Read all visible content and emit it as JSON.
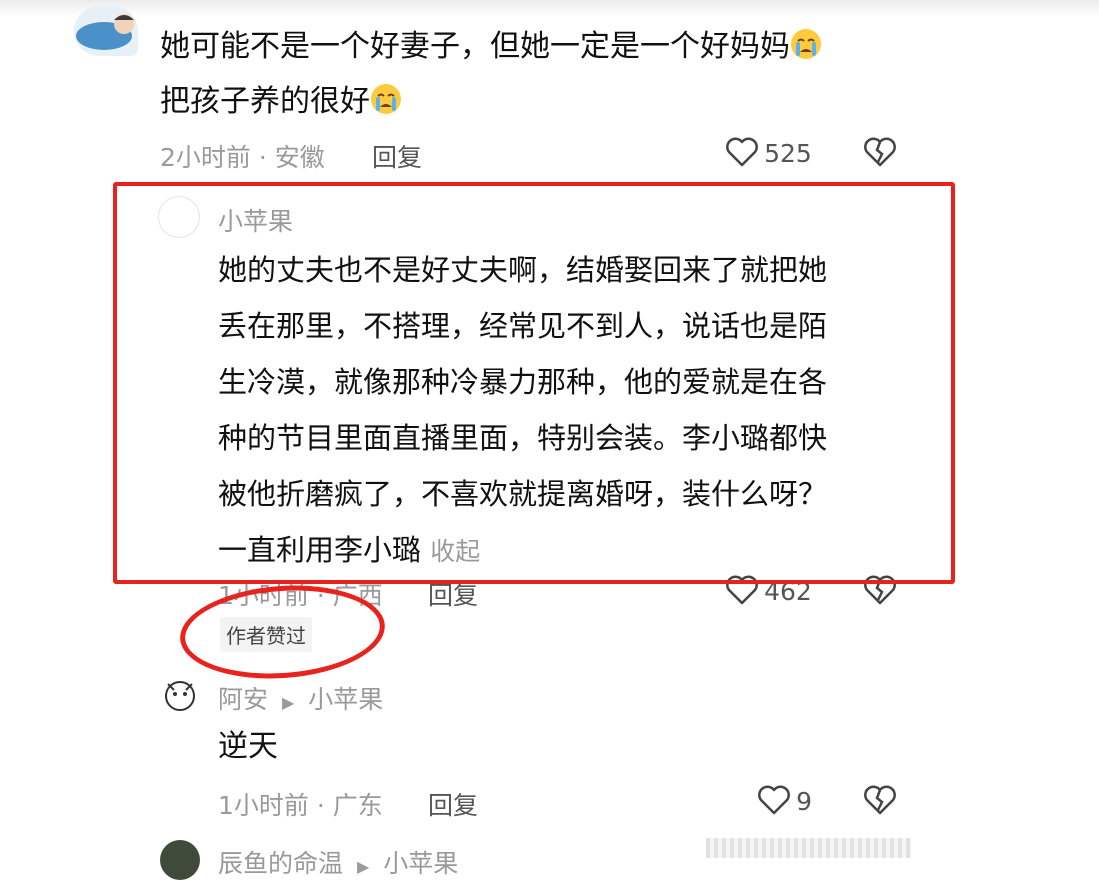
{
  "comment1": {
    "line1": "她可能不是一个好妻子，但她一定是一个好妈妈",
    "line2": "把孩子养的很好",
    "meta": "2小时前 · 安徽",
    "reply_label": "回复",
    "likes": "525",
    "emoji": "crying-face"
  },
  "reply1": {
    "author": "小苹果",
    "lines": [
      "她的丈夫也不是好丈夫啊，结婚娶回来了就把她",
      "丢在那里，不搭理，经常见不到人，说话也是陌",
      "生冷漠，就像那种冷暴力那种，他的爱就是在各",
      "种的节目里面直播里面，特别会装。李小璐都快",
      "被他折磨疯了，不喜欢就提离婚呀，装什么呀？"
    ],
    "last_line": "一直利用李小璐",
    "collapse_label": "收起",
    "meta": "1小时前 · 广西",
    "reply_label": "回复",
    "likes": "462",
    "badge": "作者赞过"
  },
  "reply2": {
    "author": "阿安",
    "reply_to": "小苹果",
    "text": "逆天",
    "meta": "1小时前 · 广东",
    "reply_label": "回复",
    "likes": "9"
  },
  "reply3": {
    "author": "辰鱼的命温",
    "reply_to": "小苹果"
  },
  "colors": {
    "highlight_red": "#e8231e",
    "meta_gray": "#9a9a9a"
  }
}
